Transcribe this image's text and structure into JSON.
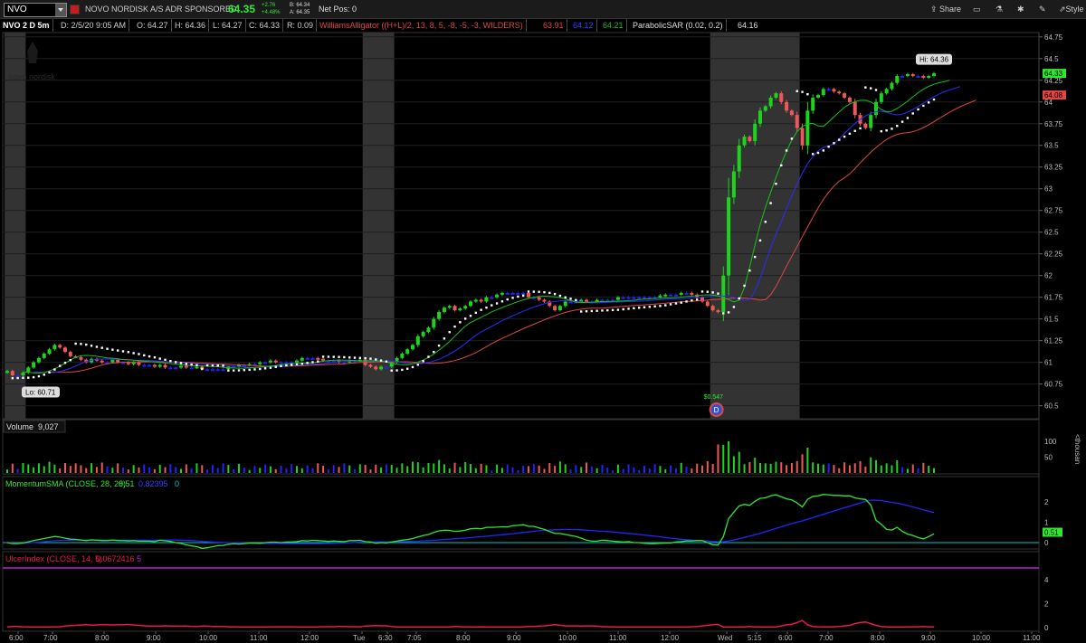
{
  "toolbar": {
    "symbol": "NVO",
    "company": "NOVO NORDISK A/S ADR SPONSORED",
    "last": "64.35",
    "change": "+2.76",
    "change_pct": "+4.48%",
    "bid": "B: 64.34",
    "ask": "A: 64.35",
    "net_pos": "Net Pos: 0",
    "share_label": "Share",
    "style_label": "Style"
  },
  "infobar": {
    "title": "NVO 2 D 5m",
    "date": "D: 2/5/20 9:05 AM",
    "open": "O: 64.27",
    "high": "H: 64.36",
    "low": "L: 64.27",
    "close": "C: 64.33",
    "range": "R: 0.09",
    "alligator": "WilliamsAlligator ((H+L)/2, 13, 8, 5, -8, -5, -3, WILDERS)",
    "jaw": "63.91",
    "teeth": "64.12",
    "lips": "64.21",
    "psar": "ParabolicSAR (0.02, 0.2)",
    "psar_val": "64.16"
  },
  "colors": {
    "up": "#1ed31e",
    "down": "#ef5858",
    "neutral": "#2222ff",
    "jaw": "#e04646",
    "teeth": "#2b2bff",
    "lips": "#17c017",
    "psar": "#ffffff",
    "ext_hours": "#333333",
    "mom": "#2ee82e",
    "momsma": "#2424ff",
    "ulcer": "#e8194a",
    "ulcer_level": "#b820d0",
    "zero": "#00c8c8"
  },
  "logo_text": "novo nordisk",
  "chart_data": [
    {
      "type": "candlestick",
      "symbol": "NVO",
      "interval": "5m",
      "ylim": [
        60.35,
        64.8
      ],
      "y_ticks": [
        "64.75",
        "64.5",
        "64.25",
        "64",
        "63.75",
        "63.5",
        "63.25",
        "63",
        "62.75",
        "62.5",
        "62.25",
        "62",
        "61.75",
        "61.5",
        "61.25",
        "61",
        "60.75",
        "60.5"
      ],
      "x_ticks": [
        "6:00",
        "7:00",
        "8:00",
        "9:00",
        "10:00",
        "11:00",
        "12:00",
        "Tue",
        "6:30",
        "7:05",
        "8:00",
        "9:00",
        "10:00",
        "11:00",
        "12:00",
        "Wed",
        "5:15",
        "6:00",
        "7:00",
        "8:00",
        "9:00",
        "10:00",
        "11:00"
      ],
      "extended_sessions": [
        [
          0,
          3
        ],
        [
          68,
          73
        ],
        [
          134,
          150
        ]
      ],
      "closes": [
        60.9,
        60.85,
        60.85,
        60.88,
        60.94,
        61.0,
        61.05,
        61.1,
        61.15,
        61.2,
        61.17,
        61.12,
        61.07,
        61.06,
        61.03,
        61.0,
        61.04,
        61.02,
        61.0,
        61.0,
        61.03,
        61.0,
        61.0,
        60.98,
        61.0,
        60.97,
        60.97,
        60.97,
        60.95,
        60.97,
        60.94,
        60.94,
        60.94,
        60.96,
        60.94,
        60.94,
        60.95,
        60.92,
        60.92,
        60.92,
        60.92,
        60.92,
        60.95,
        60.95,
        60.97,
        60.97,
        60.98,
        60.98,
        61.0,
        61.0,
        61.02,
        61.0,
        61.0,
        61.0,
        61.0,
        61.02,
        61.05,
        61.05,
        61.05,
        61.04,
        61.02,
        61.02,
        61.02,
        61.0,
        61.0,
        61.02,
        61.02,
        61.03,
        60.97,
        60.95,
        60.92,
        60.95,
        60.95,
        61.0,
        61.05,
        61.1,
        61.15,
        61.2,
        61.3,
        61.35,
        61.4,
        61.5,
        61.58,
        61.63,
        61.65,
        61.6,
        61.62,
        61.65,
        61.7,
        61.72,
        61.7,
        61.75,
        61.75,
        61.78,
        61.8,
        61.8,
        61.8,
        61.8,
        61.8,
        61.75,
        61.75,
        61.72,
        61.7,
        61.65,
        61.6,
        61.65,
        61.7,
        61.7,
        61.7,
        61.72,
        61.7,
        61.7,
        61.72,
        61.72,
        61.72,
        61.72,
        61.75,
        61.75,
        61.75,
        61.75,
        61.75,
        61.75,
        61.75,
        61.75,
        61.77,
        61.78,
        61.78,
        61.78,
        61.8,
        61.8,
        61.78,
        61.75,
        61.7,
        61.65,
        61.6,
        61.58,
        62.0,
        62.9,
        63.2,
        63.5,
        63.6,
        63.55,
        63.75,
        63.9,
        63.95,
        64.05,
        64.1,
        64.0,
        63.9,
        63.85,
        63.7,
        63.5,
        63.9,
        64.05,
        64.08,
        64.15,
        64.15,
        64.12,
        64.1,
        64.05,
        64.0,
        63.85,
        63.75,
        63.7,
        63.85,
        64.0,
        64.1,
        64.15,
        64.22,
        64.3,
        64.3,
        64.32,
        64.3,
        64.3,
        64.28,
        64.3,
        64.33
      ],
      "jaw_last": 63.91,
      "teeth_last": 64.12,
      "lips_last": 64.21,
      "psar_last": 64.16,
      "labels": {
        "hi": "Hi: 64.36",
        "lo": "Lo: 60.71",
        "last": "64.33",
        "jaw": "64.08"
      },
      "dividend": {
        "label": "$0.547",
        "marker": "D"
      }
    },
    {
      "type": "bar",
      "name": "Volume",
      "value": "9,027",
      "y_ticks": [
        "100",
        "50"
      ],
      "unit": "<thousan"
    },
    {
      "type": "line",
      "name": "MomentumSMA (CLOSE, 28, 28)",
      "mom_value": "0.51",
      "sma_value": "0.82395",
      "zero_label": "0",
      "y_ticks": [
        "2",
        "1",
        "0"
      ],
      "last_label": "0.51"
    },
    {
      "type": "line",
      "name": "UlcerIndex (CLOSE, 14, 5)",
      "value": "0.0672416",
      "level": "5",
      "y_ticks": [
        "4",
        "2",
        "0"
      ]
    }
  ]
}
